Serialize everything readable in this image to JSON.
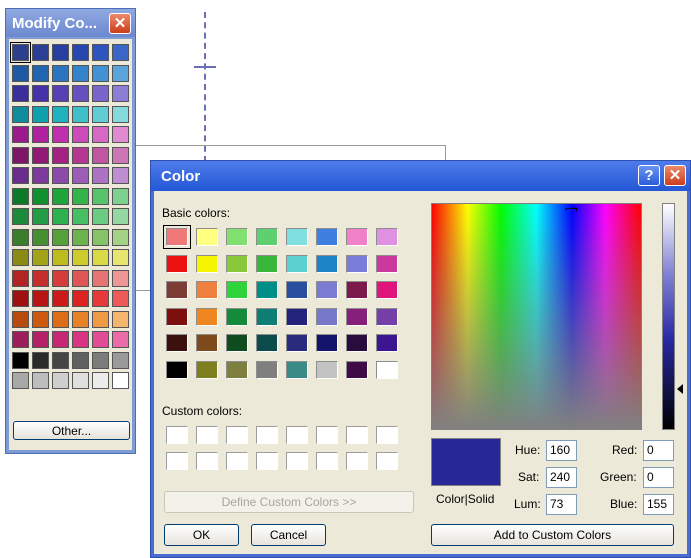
{
  "modify_window": {
    "title": "Modify Co...",
    "close_glyph": "✕",
    "other_label": "Other...",
    "palette_rows": [
      [
        "#2c3e8c",
        "#2a3f95",
        "#263fa0",
        "#2647b0",
        "#2d55be",
        "#3966c8"
      ],
      [
        "#1d5aa3",
        "#2065b0",
        "#2a74c0",
        "#3484cc",
        "#4392d4",
        "#5aa4dc"
      ],
      [
        "#3b2e9c",
        "#4532a8",
        "#5640b4",
        "#6650c0",
        "#7866cb",
        "#8c7ed6"
      ],
      [
        "#0e8b9c",
        "#10a1ae",
        "#21b3bd",
        "#3fc0c8",
        "#5fcdd3",
        "#84d9dd"
      ],
      [
        "#9a1a8e",
        "#b0219f",
        "#c12fae",
        "#cc4ab9",
        "#d569c4",
        "#df8ad1"
      ],
      [
        "#7e1566",
        "#931a74",
        "#a52283",
        "#b43891",
        "#c155a2",
        "#cd76b5"
      ],
      [
        "#6a2d8e",
        "#7b3a9c",
        "#8c4aab",
        "#9c5cb7",
        "#ae72c5",
        "#bf8dd1"
      ],
      [
        "#0d7a2a",
        "#11902e",
        "#1da53a",
        "#33b54c",
        "#57c36b",
        "#7dd08d"
      ],
      [
        "#1d8a3b",
        "#239c45",
        "#2db24f",
        "#45be64",
        "#6bcb82",
        "#93d8a3"
      ],
      [
        "#3a7d2a",
        "#468f30",
        "#56a23a",
        "#6cb34d",
        "#86c366",
        "#a3d285"
      ],
      [
        "#8a8a14",
        "#a3a318",
        "#bcbc1e",
        "#cccc2c",
        "#dada46",
        "#e6e66e"
      ],
      [
        "#b22424",
        "#c62e2e",
        "#d63c3c",
        "#e05555",
        "#e77474",
        "#ee9595"
      ],
      [
        "#a01010",
        "#b81414",
        "#cc1a1a",
        "#dd2222",
        "#e63a3a",
        "#ee5a5a"
      ],
      [
        "#b84a0e",
        "#cc5a10",
        "#dd6d16",
        "#e88227",
        "#ef9a45",
        "#f4b56c"
      ],
      [
        "#9e1d5c",
        "#b42169",
        "#c72876",
        "#d93384",
        "#e44b96",
        "#ec6ba9"
      ],
      [
        "#000000",
        "#2a2a2a",
        "#454545",
        "#606060",
        "#7c7c7c",
        "#9a9a9a"
      ],
      [
        "#a8a8a8",
        "#bdbdbd",
        "#cfcfcf",
        "#dfdfdf",
        "#ececec",
        "#ffffff"
      ]
    ]
  },
  "color_dialog": {
    "title": "Color",
    "help_glyph": "?",
    "close_glyph": "✕",
    "basic_colors_label": "Basic colors:",
    "custom_colors_label": "Custom colors:",
    "define_custom_label": "Define Custom Colors >>",
    "ok_label": "OK",
    "cancel_label": "Cancel",
    "add_custom_label": "Add to Custom Colors",
    "color_solid_label": "Color|Solid",
    "cross_marker": "⌐¬",
    "basic_colors": [
      [
        "#f07878",
        "#ffff80",
        "#80e070",
        "#5fd070",
        "#80e0e0",
        "#3f7fe0",
        "#f080c8",
        "#e090e0"
      ],
      [
        "#ee1111",
        "#f5f500",
        "#88c83a",
        "#38b83a",
        "#5ad0d0",
        "#1e84c8",
        "#7b7ed8",
        "#ca3a9e"
      ],
      [
        "#7d3c36",
        "#f08040",
        "#2fd43a",
        "#008f88",
        "#294f9f",
        "#7b7bd1",
        "#7c1a4c",
        "#e0157c"
      ],
      [
        "#7f0f0f",
        "#ef8620",
        "#158a3a",
        "#0e7d73",
        "#23237c",
        "#7878c8",
        "#861f79",
        "#743fa6"
      ],
      [
        "#3d1010",
        "#7d4a1b",
        "#0f4d1e",
        "#0c4c4c",
        "#2b2b7d",
        "#14146a",
        "#2a0d3c",
        "#3b1690"
      ],
      [
        "#000000",
        "#7f7f20",
        "#7f7f40",
        "#7f7f7f",
        "#3a8a88",
        "#c3c3c3",
        "#3e0b46",
        "#ffffff"
      ]
    ],
    "fields": {
      "hue_label": "Hue:",
      "hue_value": "160",
      "sat_label": "Sat:",
      "sat_value": "240",
      "lum_label": "Lum:",
      "lum_value": "73",
      "red_label": "Red:",
      "red_value": "0",
      "green_label": "Green:",
      "green_value": "0",
      "blue_label": "Blue:",
      "blue_value": "155"
    },
    "preview_color": "#282898"
  }
}
